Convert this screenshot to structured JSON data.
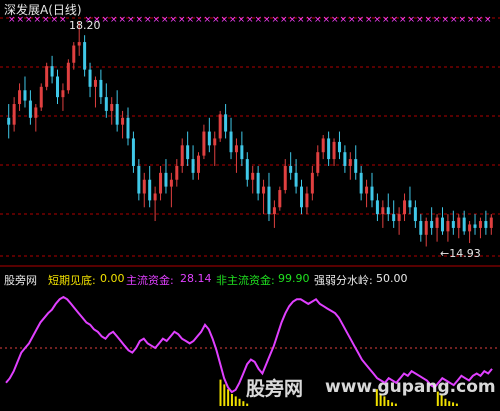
{
  "header": {
    "title": "深发展A(日线)"
  },
  "price_panel": {
    "high_label": "18.20",
    "low_label": "←14.93",
    "colors": {
      "up": "#e04040",
      "down": "#40c8e8",
      "marker": "#ff40ff",
      "grid": "#b00000"
    }
  },
  "indicator_panel": {
    "name": "股旁网",
    "items": [
      {
        "label": "短期见底:",
        "value": "0.00",
        "color": "#f0e000"
      },
      {
        "label": "主流资金:",
        "value": "28.14",
        "color": "#e040ff"
      },
      {
        "label": "非主流资金:",
        "value": "99.90",
        "color": "#20e020"
      },
      {
        "label": "强弱分水岭:",
        "value": "50.00",
        "color": "#e8e8e8"
      }
    ]
  },
  "watermark": {
    "text": "股旁网",
    "url": "www.gupang.com"
  },
  "chart_data": {
    "type": "candlestick_with_indicator",
    "candles": [
      [
        16.8,
        17.0,
        16.5,
        16.7
      ],
      [
        16.7,
        17.1,
        16.6,
        17.0
      ],
      [
        17.0,
        17.3,
        16.9,
        17.2
      ],
      [
        17.2,
        17.4,
        16.95,
        17.05
      ],
      [
        17.05,
        17.2,
        16.7,
        16.8
      ],
      [
        16.8,
        17.0,
        16.6,
        16.95
      ],
      [
        16.95,
        17.3,
        16.9,
        17.25
      ],
      [
        17.25,
        17.6,
        17.2,
        17.55
      ],
      [
        17.55,
        17.7,
        17.3,
        17.4
      ],
      [
        17.4,
        17.5,
        17.0,
        17.1
      ],
      [
        17.1,
        17.3,
        16.9,
        17.2
      ],
      [
        17.2,
        17.65,
        17.15,
        17.6
      ],
      [
        17.6,
        17.9,
        17.5,
        17.85
      ],
      [
        17.85,
        18.2,
        17.7,
        17.9
      ],
      [
        17.9,
        18.0,
        17.4,
        17.5
      ],
      [
        17.5,
        17.6,
        17.1,
        17.25
      ],
      [
        17.25,
        17.4,
        16.95,
        17.35
      ],
      [
        17.35,
        17.5,
        17.0,
        17.1
      ],
      [
        17.1,
        17.3,
        16.8,
        16.9
      ],
      [
        16.9,
        17.1,
        16.7,
        17.0
      ],
      [
        17.0,
        17.2,
        16.6,
        16.7
      ],
      [
        16.7,
        16.9,
        16.5,
        16.8
      ],
      [
        16.8,
        16.95,
        16.4,
        16.5
      ],
      [
        16.5,
        16.6,
        16.0,
        16.1
      ],
      [
        16.1,
        16.2,
        15.6,
        15.7
      ],
      [
        15.7,
        16.0,
        15.5,
        15.9
      ],
      [
        15.9,
        16.1,
        15.5,
        15.6
      ],
      [
        15.6,
        15.8,
        15.3,
        15.7
      ],
      [
        15.7,
        16.1,
        15.6,
        16.0
      ],
      [
        16.0,
        16.2,
        15.7,
        15.8
      ],
      [
        15.8,
        16.0,
        15.5,
        15.9
      ],
      [
        15.9,
        16.2,
        15.8,
        16.1
      ],
      [
        16.1,
        16.5,
        16.0,
        16.4
      ],
      [
        16.4,
        16.6,
        16.1,
        16.2
      ],
      [
        16.2,
        16.4,
        15.9,
        16.0
      ],
      [
        16.0,
        16.3,
        15.9,
        16.25
      ],
      [
        16.25,
        16.7,
        16.2,
        16.6
      ],
      [
        16.6,
        16.8,
        16.3,
        16.4
      ],
      [
        16.4,
        16.6,
        16.1,
        16.5
      ],
      [
        16.5,
        16.9,
        16.45,
        16.85
      ],
      [
        16.85,
        17.0,
        16.5,
        16.6
      ],
      [
        16.6,
        16.8,
        16.2,
        16.3
      ],
      [
        16.3,
        16.5,
        16.0,
        16.4
      ],
      [
        16.4,
        16.6,
        16.1,
        16.2
      ],
      [
        16.2,
        16.3,
        15.8,
        15.9
      ],
      [
        15.9,
        16.1,
        15.7,
        16.0
      ],
      [
        16.0,
        16.1,
        15.6,
        15.7
      ],
      [
        15.7,
        15.9,
        15.4,
        15.8
      ],
      [
        15.8,
        16.0,
        15.3,
        15.4
      ],
      [
        15.4,
        15.6,
        15.2,
        15.5
      ],
      [
        15.5,
        15.8,
        15.45,
        15.75
      ],
      [
        15.75,
        16.2,
        15.7,
        16.1
      ],
      [
        16.1,
        16.3,
        15.9,
        16.0
      ],
      [
        16.0,
        16.2,
        15.7,
        15.8
      ],
      [
        15.8,
        15.9,
        15.4,
        15.5
      ],
      [
        15.5,
        15.8,
        15.4,
        15.7
      ],
      [
        15.7,
        16.1,
        15.6,
        16.0
      ],
      [
        16.0,
        16.4,
        15.95,
        16.3
      ],
      [
        16.3,
        16.55,
        16.2,
        16.5
      ],
      [
        16.5,
        16.6,
        16.1,
        16.2
      ],
      [
        16.2,
        16.5,
        16.1,
        16.45
      ],
      [
        16.45,
        16.6,
        16.2,
        16.3
      ],
      [
        16.3,
        16.4,
        16.0,
        16.1
      ],
      [
        16.1,
        16.3,
        15.9,
        16.2
      ],
      [
        16.2,
        16.4,
        15.9,
        16.0
      ],
      [
        16.0,
        16.1,
        15.6,
        15.7
      ],
      [
        15.7,
        15.9,
        15.5,
        15.8
      ],
      [
        15.8,
        16.0,
        15.5,
        15.6
      ],
      [
        15.6,
        15.7,
        15.3,
        15.4
      ],
      [
        15.4,
        15.6,
        15.2,
        15.5
      ],
      [
        15.5,
        15.7,
        15.3,
        15.4
      ],
      [
        15.4,
        15.6,
        15.2,
        15.3
      ],
      [
        15.3,
        15.5,
        15.1,
        15.4
      ],
      [
        15.4,
        15.7,
        15.3,
        15.6
      ],
      [
        15.6,
        15.8,
        15.4,
        15.5
      ],
      [
        15.5,
        15.6,
        15.2,
        15.3
      ],
      [
        15.3,
        15.4,
        15.0,
        15.1
      ],
      [
        15.1,
        15.35,
        14.93,
        15.3
      ],
      [
        15.3,
        15.5,
        15.1,
        15.2
      ],
      [
        15.2,
        15.4,
        15.0,
        15.35
      ],
      [
        15.35,
        15.5,
        15.1,
        15.15
      ],
      [
        15.15,
        15.4,
        15.0,
        15.3
      ],
      [
        15.3,
        15.45,
        15.1,
        15.2
      ],
      [
        15.2,
        15.4,
        15.05,
        15.35
      ],
      [
        15.35,
        15.45,
        15.1,
        15.15
      ],
      [
        15.15,
        15.3,
        14.98,
        15.25
      ],
      [
        15.25,
        15.4,
        15.1,
        15.2
      ],
      [
        15.2,
        15.35,
        15.05,
        15.3
      ],
      [
        15.3,
        15.45,
        15.1,
        15.2
      ],
      [
        15.2,
        15.4,
        15.1,
        15.35
      ]
    ],
    "main_fund": [
      20,
      24,
      30,
      38,
      46,
      50,
      54,
      60,
      66,
      72,
      76,
      80,
      83,
      88,
      92,
      94,
      92,
      88,
      84,
      80,
      76,
      72,
      70,
      66,
      64,
      60,
      58,
      62,
      64,
      60,
      56,
      52,
      48,
      46,
      50,
      56,
      58,
      54,
      52,
      50,
      54,
      58,
      56,
      60,
      64,
      62,
      58,
      56,
      54,
      56,
      60,
      64,
      70,
      66,
      58,
      48,
      36,
      24,
      16,
      12,
      14,
      20,
      28,
      36,
      40,
      38,
      32,
      28,
      36,
      44,
      52,
      62,
      72,
      80,
      86,
      90,
      92,
      92,
      90,
      88,
      90,
      92,
      88,
      86,
      84,
      82,
      80,
      76,
      70,
      64,
      58,
      52,
      46,
      40,
      36,
      32,
      28,
      24,
      22,
      20,
      24,
      22,
      20,
      24,
      28,
      26,
      30,
      28,
      26,
      24,
      22,
      18,
      16,
      20,
      24,
      22,
      20,
      18,
      22,
      26,
      24,
      22,
      26,
      28,
      26,
      30,
      28,
      32
    ],
    "bottom_bars": [
      0,
      0,
      0,
      0,
      0,
      0,
      0,
      0,
      0,
      0,
      0,
      0,
      0,
      0,
      0,
      0,
      0,
      0,
      0,
      0,
      0,
      0,
      0,
      0,
      0,
      0,
      0,
      0,
      0,
      0,
      0,
      0,
      0,
      0,
      0,
      0,
      0,
      0,
      0,
      0,
      0,
      0,
      0,
      0,
      0,
      0,
      0,
      0,
      0,
      0,
      0,
      0,
      0,
      0,
      0,
      0,
      22,
      18,
      14,
      10,
      8,
      6,
      4,
      2,
      0,
      0,
      0,
      0,
      0,
      0,
      0,
      0,
      0,
      0,
      0,
      0,
      0,
      0,
      0,
      0,
      0,
      0,
      0,
      0,
      0,
      0,
      0,
      0,
      0,
      0,
      0,
      0,
      0,
      0,
      0,
      0,
      0,
      14,
      10,
      8,
      5,
      3,
      2,
      0,
      0,
      0,
      0,
      0,
      0,
      0,
      0,
      0,
      0,
      12,
      9,
      6,
      4,
      3,
      2,
      0,
      0,
      0,
      0,
      0,
      0,
      0,
      0,
      0
    ],
    "threshold": 50
  }
}
